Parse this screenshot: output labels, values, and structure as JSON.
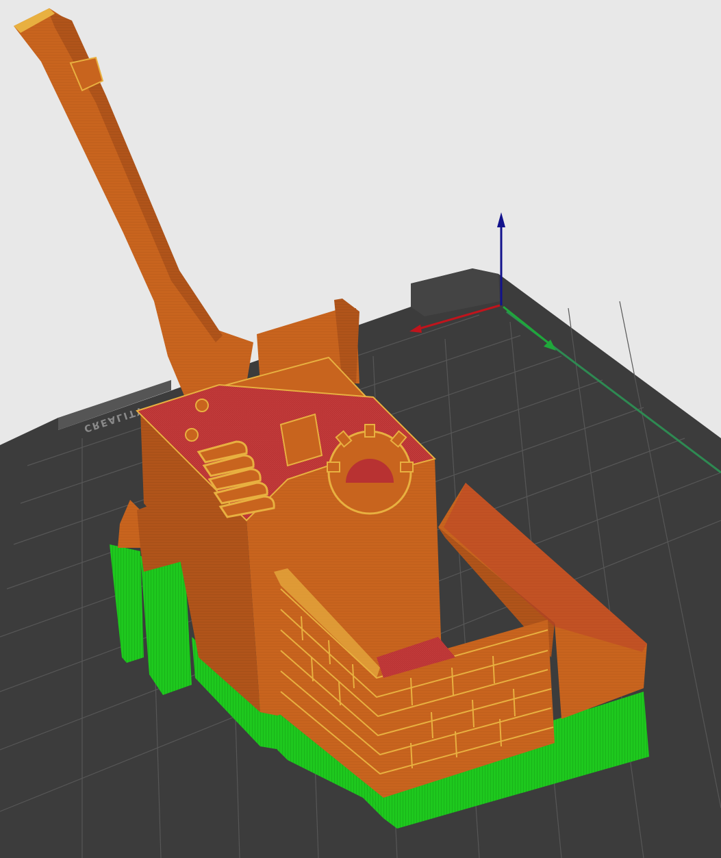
{
  "viewport": {
    "background": "#e8e8e8",
    "bed": {
      "brand_label": "CREALITY",
      "surface_color": "#3c3c3c",
      "edge_color": "#2a2a2a",
      "grid_color": "#5a5a5a",
      "major_grid_color": "#8a8a8a"
    },
    "axes": {
      "x_color": "#c0141c",
      "y_color": "#1fa83a",
      "z_color": "#12128c",
      "x_name": "x-axis-arrow",
      "y_name": "y-axis-arrow",
      "z_name": "z-axis-arrow"
    },
    "model": {
      "wall_color": "#c8641e",
      "top_color": "#b83232",
      "support_color": "#1ec81e",
      "highlight_color": "#e8b040",
      "shade_color": "#a85018",
      "features": [
        "lever-arm",
        "gear",
        "slot-holes",
        "brick-wall",
        "support-structures"
      ]
    }
  }
}
